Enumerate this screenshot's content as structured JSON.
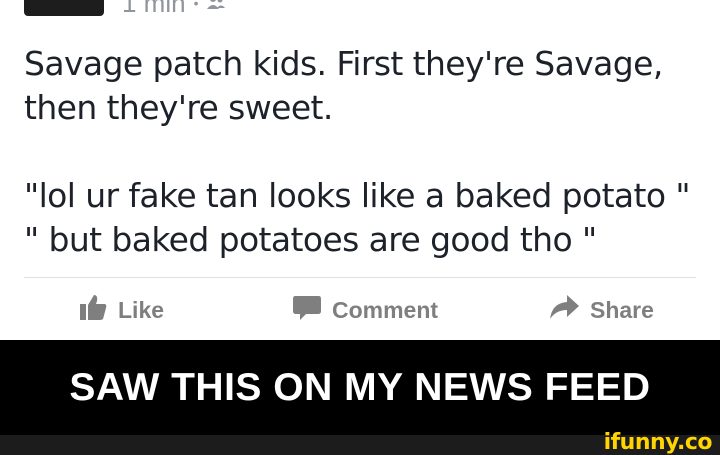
{
  "post": {
    "timestamp": "1 min",
    "separator": "•",
    "privacy_icon": "friends-icon",
    "status_line1": "Savage patch kids.  First they're Savage,",
    "status_line2": "then they're sweet.",
    "status_line3": "\"lol ur fake tan looks like a baked potato \"",
    "status_line4": "\" but baked potatoes are good tho \"",
    "actions": {
      "like_label": "Like",
      "comment_label": "Comment",
      "share_label": "Share"
    }
  },
  "caption": {
    "text": "SAW THIS ON MY NEWS FEED"
  },
  "watermark": {
    "text": "ifunny.co"
  },
  "colors": {
    "action_gray": "#7f7f7f",
    "meta_gray": "#90949c",
    "text_dark": "#1d2129",
    "watermark_yellow": "#ffd400"
  }
}
